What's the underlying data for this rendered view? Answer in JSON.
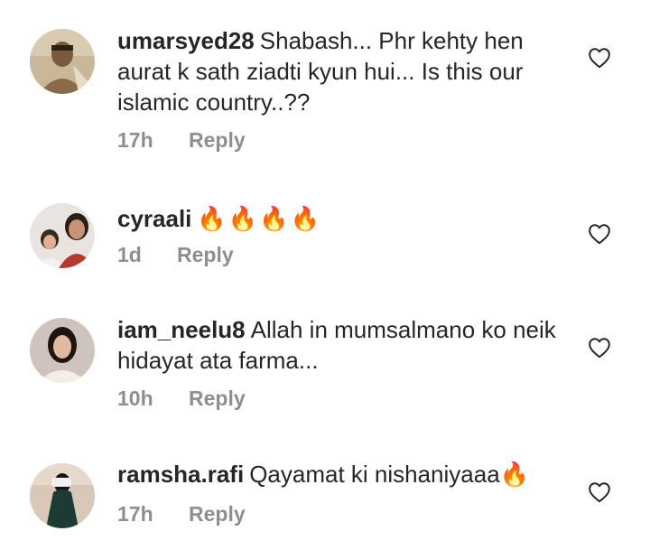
{
  "comments": [
    {
      "username": "umarsyed28",
      "text": "Shabash... Phr kehty hen aurat k sath ziadti kyun hui... Is this our islamic country..??",
      "time": "17h",
      "reply_label": "Reply"
    },
    {
      "username": "cyraali",
      "text": "🔥🔥🔥🔥",
      "time": "1d",
      "reply_label": "Reply"
    },
    {
      "username": "iam_neelu8",
      "text": "Allah in mumsalmano ko neik hidayat ata farma...",
      "time": "10h",
      "reply_label": "Reply"
    },
    {
      "username": "ramsha.rafi",
      "text": "Qayamat ki nishaniyaaa🔥",
      "time": "17h",
      "reply_label": "Reply"
    }
  ],
  "icons": {
    "like": "heart-outline-icon"
  },
  "colors": {
    "text": "#262626",
    "meta": "#8e8e8e",
    "fire": "#ff8a00"
  }
}
